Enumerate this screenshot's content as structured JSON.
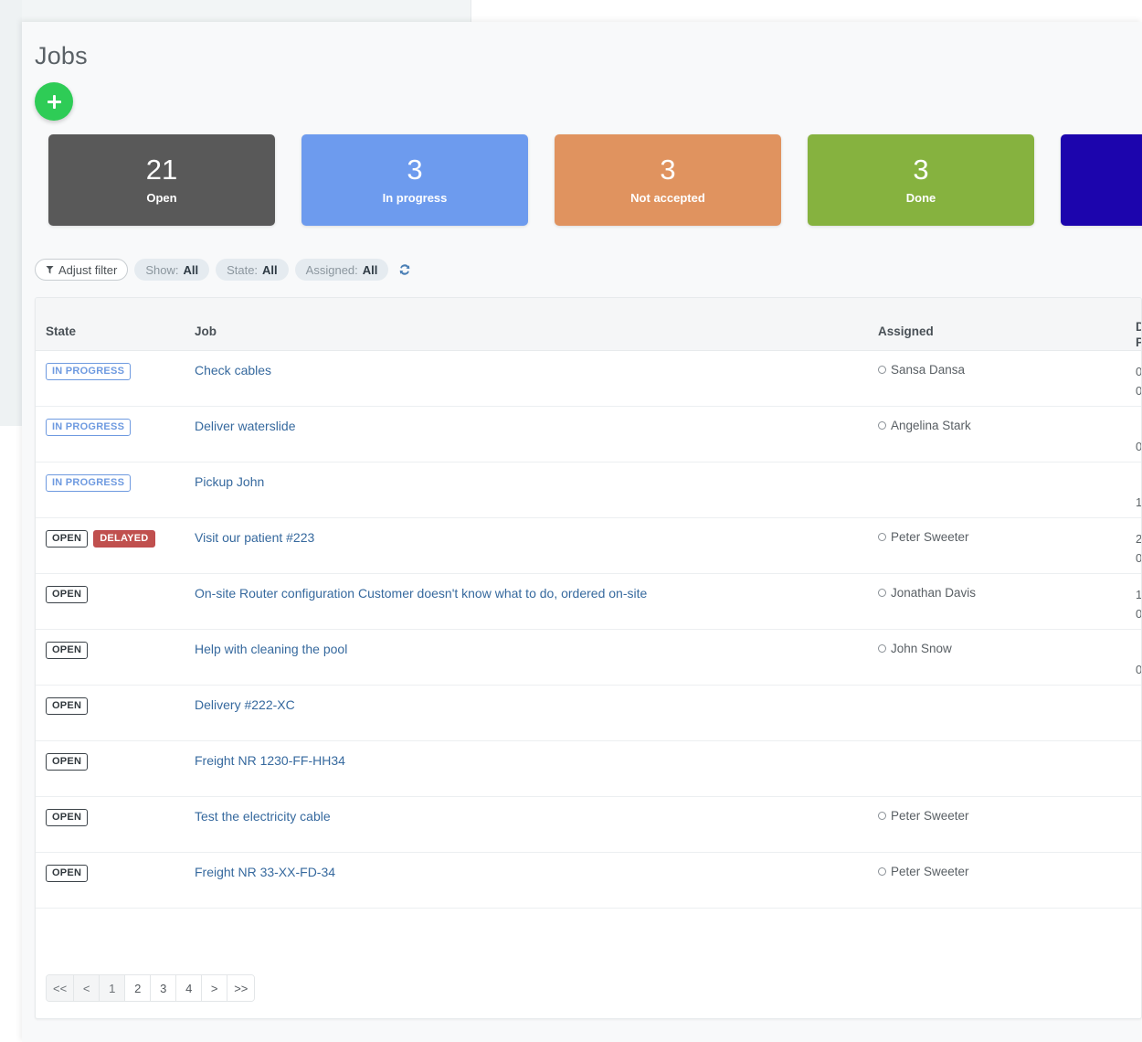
{
  "page": {
    "title": "Jobs",
    "add_button_label": "+",
    "add_button_icon": "plus-icon"
  },
  "stats": [
    {
      "value": "21",
      "label": "Open",
      "color": "#595959"
    },
    {
      "value": "3",
      "label": "In progress",
      "color": "#6d9bee"
    },
    {
      "value": "3",
      "label": "Not accepted",
      "color": "#e0935f"
    },
    {
      "value": "3",
      "label": "Done",
      "color": "#86b23f"
    },
    {
      "value": "",
      "label": "",
      "color": "#1c05ad"
    }
  ],
  "filters": {
    "adjust_label": "Adjust filter",
    "chips": [
      {
        "label": "Show:",
        "value": "All"
      },
      {
        "label": "State:",
        "value": "All"
      },
      {
        "label": "Assigned:",
        "value": "All"
      }
    ],
    "refresh_icon": "refresh-icon"
  },
  "table": {
    "columns": {
      "state": "State",
      "job": "Job",
      "assigned": "Assigned",
      "date_line1": "D",
      "date_line2": "P"
    },
    "rows": [
      {
        "badges": [
          {
            "text": "IN PROGRESS",
            "kind": "inprogress"
          }
        ],
        "job": "Check cables",
        "assigned": "Sansa Dansa",
        "date1": "0",
        "date2": "0"
      },
      {
        "badges": [
          {
            "text": "IN PROGRESS",
            "kind": "inprogress"
          }
        ],
        "job": "Deliver waterslide",
        "assigned": "Angelina Stark",
        "date1": "",
        "date2": "0"
      },
      {
        "badges": [
          {
            "text": "IN PROGRESS",
            "kind": "inprogress"
          }
        ],
        "job": "Pickup John",
        "assigned": "",
        "date1": "",
        "date2": "1"
      },
      {
        "badges": [
          {
            "text": "OPEN",
            "kind": "open"
          },
          {
            "text": "DELAYED",
            "kind": "delayed"
          }
        ],
        "job": "Visit our patient #223",
        "assigned": "Peter Sweeter",
        "date1": "2",
        "date2": "0"
      },
      {
        "badges": [
          {
            "text": "OPEN",
            "kind": "open"
          }
        ],
        "job": "On-site Router configuration Customer doesn't know what to do, ordered on-site",
        "assigned": "Jonathan Davis",
        "date1": "1",
        "date2": "0"
      },
      {
        "badges": [
          {
            "text": "OPEN",
            "kind": "open"
          }
        ],
        "job": "Help with cleaning the pool",
        "assigned": "John Snow",
        "date1": "",
        "date2": "0"
      },
      {
        "badges": [
          {
            "text": "OPEN",
            "kind": "open"
          }
        ],
        "job": "Delivery #222-XC",
        "assigned": "",
        "date1": "",
        "date2": ""
      },
      {
        "badges": [
          {
            "text": "OPEN",
            "kind": "open"
          }
        ],
        "job": "Freight NR 1230-FF-HH34",
        "assigned": "",
        "date1": "",
        "date2": ""
      },
      {
        "badges": [
          {
            "text": "OPEN",
            "kind": "open"
          }
        ],
        "job": "Test the electricity cable",
        "assigned": "Peter Sweeter",
        "date1": "",
        "date2": ""
      },
      {
        "badges": [
          {
            "text": "OPEN",
            "kind": "open"
          }
        ],
        "job": "Freight NR 33-XX-FD-34",
        "assigned": "Peter Sweeter",
        "date1": "",
        "date2": ""
      }
    ]
  },
  "pagination": {
    "buttons": [
      {
        "label": "<<",
        "active": true
      },
      {
        "label": "<",
        "active": true
      },
      {
        "label": "1",
        "active": true
      },
      {
        "label": "2",
        "active": false
      },
      {
        "label": "3",
        "active": false
      },
      {
        "label": "4",
        "active": false
      },
      {
        "label": ">",
        "active": false
      },
      {
        "label": ">>",
        "active": false
      }
    ]
  }
}
